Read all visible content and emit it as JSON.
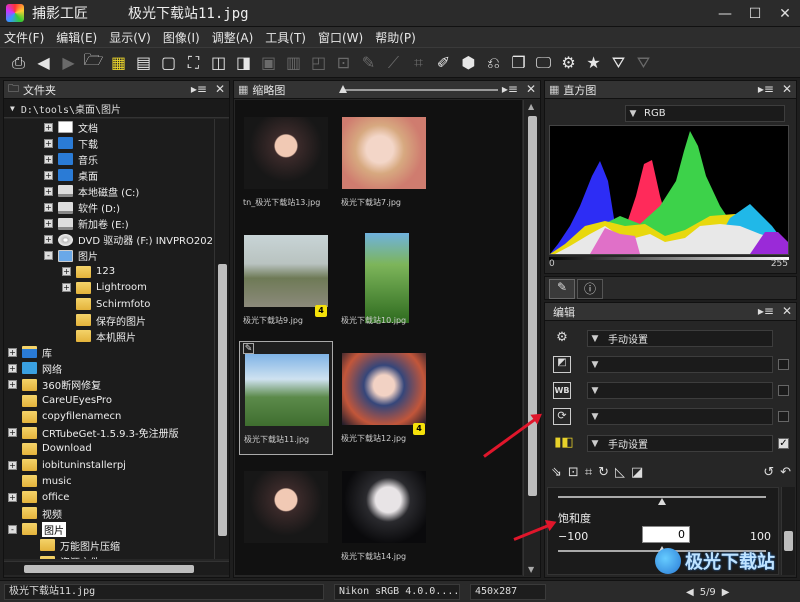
{
  "window": {
    "app_name": "捕影工匠",
    "doc_name": "极光下载站11.jpg"
  },
  "menu": [
    "文件(F)",
    "编辑(E)",
    "显示(V)",
    "图像(I)",
    "调整(A)",
    "工具(T)",
    "窗口(W)",
    "帮助(P)"
  ],
  "folder_panel": {
    "title": "文件夹",
    "path": "D:\\tools\\桌面\\图片",
    "tree": [
      {
        "label": "文档",
        "indent": 2,
        "exp": "+",
        "icon": "doc"
      },
      {
        "label": "下载",
        "indent": 2,
        "exp": "+",
        "icon": "download"
      },
      {
        "label": "音乐",
        "indent": 2,
        "exp": "+",
        "icon": "music"
      },
      {
        "label": "桌面",
        "indent": 2,
        "exp": "+",
        "icon": "desktop"
      },
      {
        "label": "本地磁盘 (C:)",
        "indent": 2,
        "exp": "+",
        "icon": "drive"
      },
      {
        "label": "软件 (D:)",
        "indent": 2,
        "exp": "+",
        "icon": "drive"
      },
      {
        "label": "新加卷 (E:)",
        "indent": 2,
        "exp": "+",
        "icon": "drive"
      },
      {
        "label": "DVD 驱动器 (F:) INVPRO202",
        "indent": 2,
        "exp": "+",
        "icon": "dvd"
      },
      {
        "label": "图片",
        "indent": 2,
        "exp": "-",
        "icon": "pictures"
      },
      {
        "label": "123",
        "indent": 3,
        "exp": "+",
        "icon": "folder"
      },
      {
        "label": "Lightroom",
        "indent": 3,
        "exp": "+",
        "icon": "folder"
      },
      {
        "label": "Schirmfoto",
        "indent": 3,
        "exp": "",
        "icon": "folder"
      },
      {
        "label": "保存的图片",
        "indent": 3,
        "exp": "",
        "icon": "folder"
      },
      {
        "label": "本机照片",
        "indent": 3,
        "exp": "",
        "icon": "folder"
      },
      {
        "label": "库",
        "indent": 0,
        "exp": "+",
        "icon": "library"
      },
      {
        "label": "网络",
        "indent": 0,
        "exp": "+",
        "icon": "network"
      },
      {
        "label": "360断网修复",
        "indent": 0,
        "exp": "+",
        "icon": "folder"
      },
      {
        "label": "CareUEyesPro",
        "indent": 0,
        "exp": "",
        "icon": "folder"
      },
      {
        "label": "copyfilenamecn",
        "indent": 0,
        "exp": "",
        "icon": "folder"
      },
      {
        "label": "CRTubeGet-1.5.9.3-免注册版",
        "indent": 0,
        "exp": "+",
        "icon": "folder"
      },
      {
        "label": "Download",
        "indent": 0,
        "exp": "",
        "icon": "folder"
      },
      {
        "label": "iobituninstallerpj",
        "indent": 0,
        "exp": "+",
        "icon": "folder"
      },
      {
        "label": "music",
        "indent": 0,
        "exp": "",
        "icon": "folder"
      },
      {
        "label": "office",
        "indent": 0,
        "exp": "+",
        "icon": "folder"
      },
      {
        "label": "视频",
        "indent": 0,
        "exp": "",
        "icon": "folder"
      },
      {
        "label": "图片",
        "indent": 0,
        "exp": "-",
        "icon": "folder",
        "selected": true
      },
      {
        "label": "万能图片压缩",
        "indent": 1,
        "exp": "",
        "icon": "folder"
      },
      {
        "label": "资源文件",
        "indent": 1,
        "exp": "",
        "icon": "folder"
      }
    ]
  },
  "thumb_panel": {
    "title": "缩略图",
    "items": [
      {
        "label": "tn_极光下载站13.jpg",
        "rating": ""
      },
      {
        "label": "极光下载站7.jpg",
        "rating": ""
      },
      {
        "label": "极光下载站9.jpg",
        "rating": "4"
      },
      {
        "label": "极光下载站10.jpg",
        "rating": ""
      },
      {
        "label": "极光下载站11.jpg",
        "rating": "",
        "selected": true
      },
      {
        "label": "极光下载站12.jpg",
        "rating": "4"
      },
      {
        "label": "",
        "rating": ""
      },
      {
        "label": "极光下载站14.jpg",
        "rating": ""
      }
    ]
  },
  "histogram_panel": {
    "title": "直方图",
    "channel": "RGB",
    "range_min": "0",
    "range_max": "255"
  },
  "edit_panel": {
    "title": "编辑",
    "rows": [
      {
        "icon": "gear-icon",
        "value": "手动设置"
      },
      {
        "icon": "exposure-icon",
        "value": ""
      },
      {
        "icon": "wb-icon",
        "value": ""
      },
      {
        "icon": "rotate-icon",
        "value": ""
      },
      {
        "icon": "picture-control-icon",
        "value": "手动设置"
      }
    ],
    "saturation_label": "饱和度",
    "saturation_min": "−100",
    "saturation_max": "100",
    "saturation_value": "0"
  },
  "status": {
    "file": "极光下载站11.jpg",
    "profile": "Nikon sRGB 4.0.0....",
    "dimensions": "450x287",
    "page": "5/9"
  },
  "watermark": "极光下载站"
}
